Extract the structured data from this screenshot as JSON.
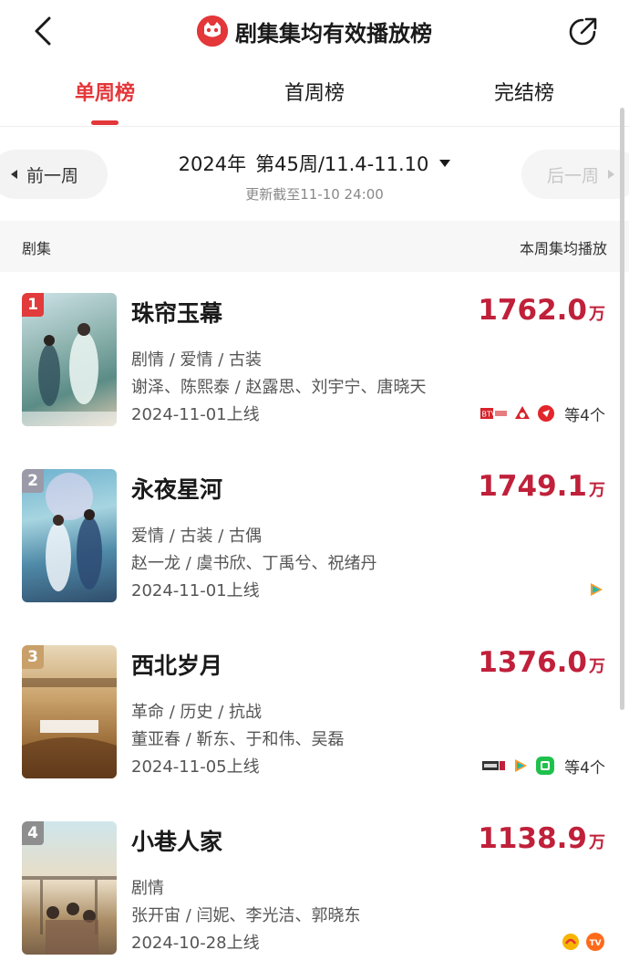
{
  "header": {
    "title": "剧集集均有效播放榜"
  },
  "tabs": [
    {
      "label": "单周榜",
      "active": true
    },
    {
      "label": "首周榜",
      "active": false
    },
    {
      "label": "完结榜",
      "active": false
    }
  ],
  "week_nav": {
    "prev_label": "前一周",
    "next_label": "后一周",
    "year": "2024年",
    "week": "第45周/11.4-11.10",
    "update_time": "更新截至11-10  24:00"
  },
  "list_header": {
    "left": "剧集",
    "right": "本周集均播放"
  },
  "items": [
    {
      "rank": "1",
      "name": "珠帘玉幕",
      "genre": "剧情 / 爱情 / 古装",
      "cast": "谢泽、陈熙泰 / 赵露思、刘宇宁、唐晓天",
      "release": "2024-11-01上线",
      "plays": "1762.0",
      "unit": "万",
      "more": "等4个",
      "rank_color": "#e23b3b",
      "platforms": [
        "btv-icon",
        "cctv-icon",
        "mango-icon"
      ]
    },
    {
      "rank": "2",
      "name": "永夜星河",
      "genre": "爱情 / 古装 / 古偶",
      "cast": "赵一龙 / 虞书欣、丁禹兮、祝绪丹",
      "release": "2024-11-01上线",
      "plays": "1749.1",
      "unit": "万",
      "more": "",
      "rank_color": "#9a9aa8",
      "platforms": [
        "tencent-video-icon"
      ]
    },
    {
      "rank": "3",
      "name": "西北岁月",
      "genre": "革命 / 历史 / 抗战",
      "cast": "董亚春 / 靳东、于和伟、吴磊",
      "release": "2024-11-05上线",
      "plays": "1376.0",
      "unit": "万",
      "more": "等4个",
      "rank_color": "#c9a06a",
      "platforms": [
        "cctv1-icon",
        "tencent-video-icon",
        "iqiyi-icon"
      ]
    },
    {
      "rank": "4",
      "name": "小巷人家",
      "genre": "剧情",
      "cast": "张开宙 / 闫妮、李光洁、郭晓东",
      "release": "2024-10-28上线",
      "plays": "1138.9",
      "unit": "万",
      "more": "",
      "rank_color": "#8e8e8e",
      "platforms": [
        "hunan-tv-icon",
        "mango-tv-icon"
      ]
    }
  ]
}
